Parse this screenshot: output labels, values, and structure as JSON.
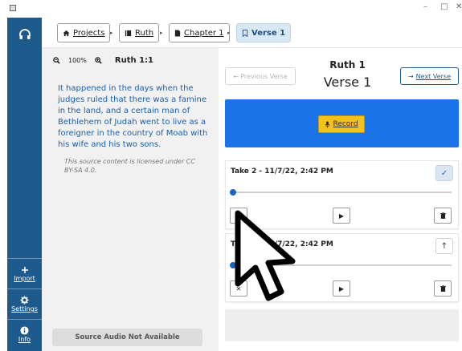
{
  "window": {
    "controls": [
      "–",
      "□",
      "✕"
    ]
  },
  "rail": {
    "top_icon": "headphones-icon",
    "items": [
      {
        "label": "Import",
        "icon": "plus-icon"
      },
      {
        "label": "Settings",
        "icon": "gear-icon"
      },
      {
        "label": "Info",
        "icon": "info-icon"
      }
    ]
  },
  "breadcrumbs": [
    {
      "label": "Projects",
      "icon": "home-icon"
    },
    {
      "label": "Ruth",
      "icon": "book-icon"
    },
    {
      "label": "Chapter 1",
      "icon": "file-icon"
    },
    {
      "label": "Verse 1",
      "icon": "bookmark-icon",
      "current": true
    }
  ],
  "source": {
    "zoom": "100%",
    "reference": "Ruth 1:1",
    "text": "It happened in the days when the judges ruled that there was a famine in the land, and a certain man of Bethlehem of Judah went to live as a foreigner in the country of Moab with his wife and his two sons.",
    "license": "This source content is licensed under CC BY-SA 4.0.",
    "audio_status": "Source Audio Not Available"
  },
  "main": {
    "book": "Ruth 1",
    "verse": "Verse 1",
    "prev_label": "← Previous Verse",
    "next_label": "Next Verse",
    "record_label": "Record",
    "takes": [
      {
        "title": "Take 2 - 11/7/22, 2:42 PM",
        "corner": "✓",
        "selected": true,
        "progress": 0
      },
      {
        "title": "Take 1 - 11/7/22, 2:42 PM",
        "corner": "↑",
        "selected": false,
        "progress": 0
      }
    ]
  },
  "colors": {
    "rail": "#1f5a8c",
    "record_band": "#1a73e8",
    "record_button": "#f5c11b",
    "link": "#1a5ea8"
  }
}
